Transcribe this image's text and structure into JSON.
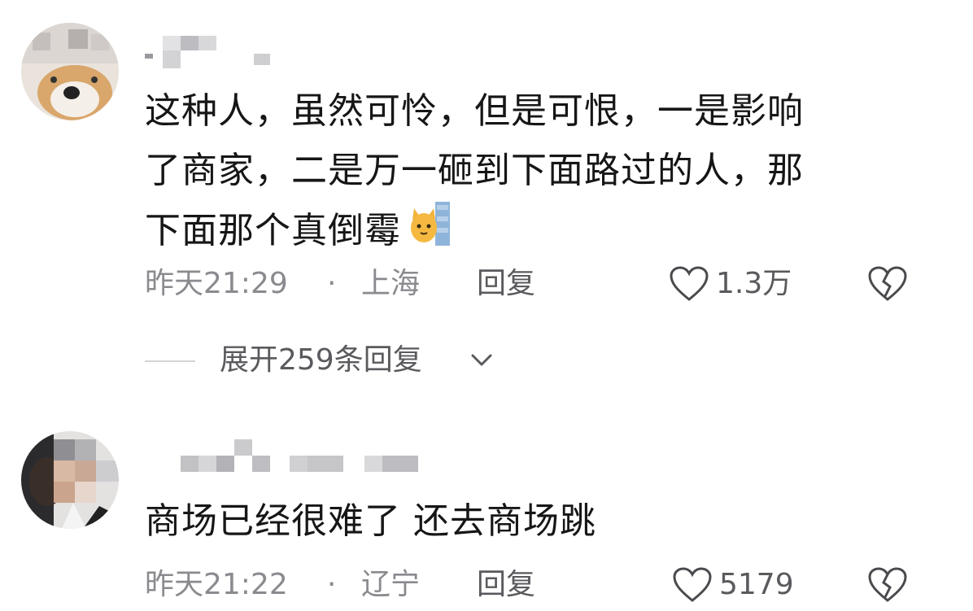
{
  "comments": [
    {
      "avatar_icon": "dog-avatar",
      "username_blurred": true,
      "lines": [
        "这种人，虽然可怜，但是可恨，一是影响",
        "了商家，二是万一砸到下面路过的人，那",
        "下面那个真倒霉"
      ],
      "emoji_icon": "cat-peeking-emoji",
      "time": "昨天21:29",
      "separator": "·",
      "location": "上海",
      "reply_label": "回复",
      "like_count": "1.3万",
      "like_icon": "heart-outline-icon",
      "dislike_icon": "broken-heart-icon"
    },
    {
      "avatar_icon": "person-avatar",
      "username_blurred": true,
      "lines": [
        "商场已经很难了 还去商场跳"
      ],
      "time": "昨天21:22",
      "separator": "·",
      "location": "辽宁",
      "reply_label": "回复",
      "like_count": "5179",
      "like_icon": "heart-outline-icon",
      "dislike_icon": "broken-heart-icon"
    }
  ],
  "expand_replies": {
    "label": "展开259条回复",
    "icon": "chevron-down-icon"
  },
  "colors": {
    "text": "#161616",
    "meta": "#8a8a8f",
    "action": "#5a5a5e",
    "pixelation": "#c9c9cc"
  }
}
